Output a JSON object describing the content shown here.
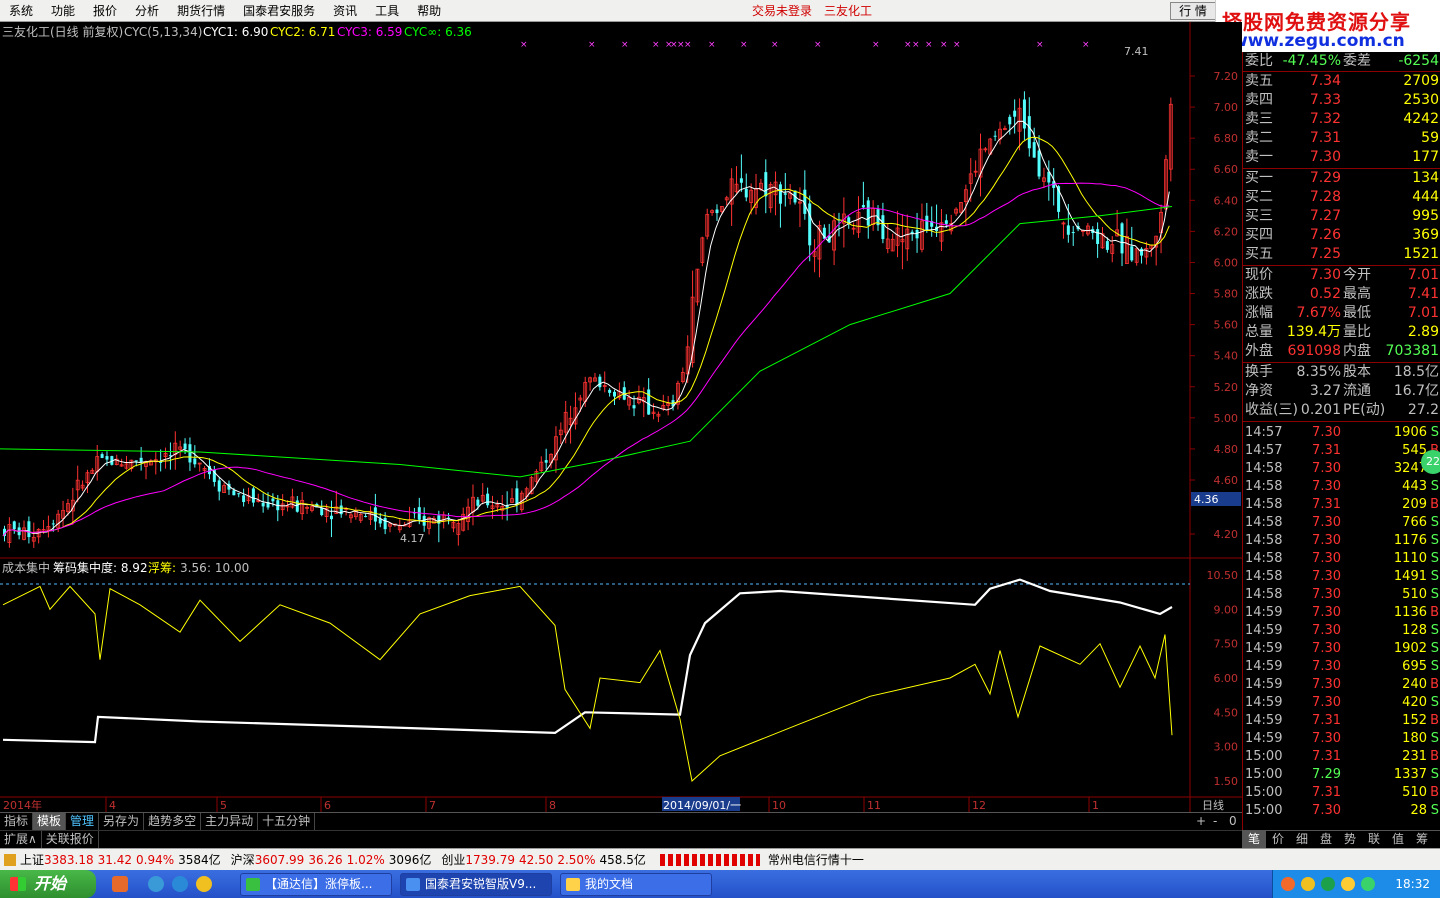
{
  "menu": {
    "items": [
      "系统",
      "功能",
      "报价",
      "分析",
      "期货行情",
      "国泰君安服务",
      "资讯",
      "工具",
      "帮助"
    ],
    "login": "交易未登录",
    "stock_name": "三友化工",
    "quote_btn": "行 情"
  },
  "watermark": {
    "line1": "择股网免费资源分享",
    "line2": "www.zegu.com.cn"
  },
  "chart_header": {
    "title": "三友化工(日线 前复权)",
    "ind": "CYC(5,13,34)",
    "c1": "CYC1: 6.90",
    "c2": "CYC2: 6.71",
    "c3": "CYC3: 6.59",
    "c4": "CYC∞: 6.36"
  },
  "sub_header": {
    "name": "成本集中",
    "a": "筹码集中度: 8.92",
    "b": "浮筹:",
    "c": "3.56",
    "d": ": 10.00"
  },
  "chart_data": {
    "type": "line",
    "price_axis": [
      "7.20",
      "7.00",
      "6.80",
      "6.60",
      "6.40",
      "6.20",
      "6.00",
      "5.80",
      "5.60",
      "5.40",
      "5.20",
      "5.00",
      "4.80",
      "4.60",
      "4.20"
    ],
    "price_marker": "4.36",
    "sub_axis": [
      "10.50",
      "9.00",
      "7.50",
      "6.00",
      "4.50",
      "3.00",
      "1.50"
    ],
    "x_labels": [
      "2014年",
      "4",
      "5",
      "6",
      "7",
      "8",
      "2014/09/01/一",
      "10",
      "11",
      "12",
      "1"
    ],
    "x_right": "日线",
    "high_label": "7.41",
    "low_label": "4.17",
    "ylim": [
      4.0,
      7.5
    ],
    "sub_ylim": [
      1.0,
      11.0
    ]
  },
  "tabs": [
    "指标",
    "模板",
    "管理",
    "另存为",
    "趋势多空",
    "主力异动",
    "十五分钟"
  ],
  "tabs2": [
    "扩展∧",
    "关联报价"
  ],
  "quote": {
    "wb": {
      "label": "委比",
      "value": "-47.45%",
      "label2": "委差",
      "value2": "-6254"
    },
    "sells": [
      {
        "label": "卖五",
        "price": "7.34",
        "vol": "2709"
      },
      {
        "label": "卖四",
        "price": "7.33",
        "vol": "2530"
      },
      {
        "label": "卖三",
        "price": "7.32",
        "vol": "4242"
      },
      {
        "label": "卖二",
        "price": "7.31",
        "vol": "59"
      },
      {
        "label": "卖一",
        "price": "7.30",
        "vol": "177"
      }
    ],
    "buys": [
      {
        "label": "买一",
        "price": "7.29",
        "vol": "134"
      },
      {
        "label": "买二",
        "price": "7.28",
        "vol": "444"
      },
      {
        "label": "买三",
        "price": "7.27",
        "vol": "995"
      },
      {
        "label": "买四",
        "price": "7.26",
        "vol": "369"
      },
      {
        "label": "买五",
        "price": "7.25",
        "vol": "1521"
      }
    ],
    "stats": [
      {
        "l1": "现价",
        "v1": "7.30",
        "l2": "今开",
        "v2": "7.01"
      },
      {
        "l1": "涨跌",
        "v1": "0.52",
        "l2": "最高",
        "v2": "7.41"
      },
      {
        "l1": "涨幅",
        "v1": "7.67%",
        "l2": "最低",
        "v2": "7.01"
      },
      {
        "l1": "总量",
        "v1": "139.4万",
        "l2": "量比",
        "v2": "2.89"
      },
      {
        "l1": "外盘",
        "v1": "691098",
        "l2": "内盘",
        "v2": "703381"
      },
      {
        "l1": "换手",
        "v1": "8.35%",
        "l2": "股本",
        "v2": "18.5亿"
      },
      {
        "l1": "净资",
        "v1": "3.27",
        "l2": "流通",
        "v2": "16.7亿"
      },
      {
        "l1": "收益(三)",
        "v1": "0.201",
        "l2": "PE(动)",
        "v2": "27.2"
      }
    ],
    "ticks": [
      [
        "14:57",
        "7.30",
        "1906",
        "S"
      ],
      [
        "14:57",
        "7.31",
        "545",
        "B"
      ],
      [
        "14:58",
        "7.30",
        "3247",
        "S"
      ],
      [
        "14:58",
        "7.30",
        "443",
        "S"
      ],
      [
        "14:58",
        "7.31",
        "209",
        "B"
      ],
      [
        "14:58",
        "7.30",
        "766",
        "S"
      ],
      [
        "14:58",
        "7.30",
        "1176",
        "S"
      ],
      [
        "14:58",
        "7.30",
        "1110",
        "S"
      ],
      [
        "14:58",
        "7.30",
        "1491",
        "S"
      ],
      [
        "14:58",
        "7.30",
        "510",
        "S"
      ],
      [
        "14:59",
        "7.30",
        "1136",
        "B"
      ],
      [
        "14:59",
        "7.30",
        "128",
        "S"
      ],
      [
        "14:59",
        "7.30",
        "1902",
        "S"
      ],
      [
        "14:59",
        "7.30",
        "695",
        "S"
      ],
      [
        "14:59",
        "7.30",
        "240",
        "B"
      ],
      [
        "14:59",
        "7.30",
        "420",
        "S"
      ],
      [
        "14:59",
        "7.31",
        "152",
        "B"
      ],
      [
        "14:59",
        "7.30",
        "180",
        "S"
      ],
      [
        "15:00",
        "7.31",
        "231",
        "B"
      ],
      [
        "15:00",
        "7.29",
        "1337",
        "S"
      ],
      [
        "15:00",
        "7.31",
        "510",
        "B"
      ],
      [
        "15:00",
        "7.30",
        "28",
        "S"
      ]
    ],
    "badge": "22"
  },
  "rtabs": [
    "笔",
    "价",
    "细",
    "盘",
    "势",
    "联",
    "值",
    "筹"
  ],
  "status": [
    {
      "name": "上证",
      "val": "3383.18",
      "chg": "31.42",
      "pct": "0.94%",
      "amt": "3584亿"
    },
    {
      "name": "沪深",
      "val": "3607.99",
      "chg": "36.26",
      "pct": "1.02%",
      "amt": "3096亿"
    },
    {
      "name": "创业",
      "val": "1739.79",
      "chg": "42.50",
      "pct": "2.50%",
      "amt": "458.5亿"
    }
  ],
  "status_news": "常州电信行情十一",
  "taskbar": {
    "start": "开始",
    "tasks": [
      "【通达信】涨停板...",
      "国泰君安锐智版V9...",
      "我的文档"
    ],
    "time": "18:32"
  },
  "colors": {
    "up": "#ff3232",
    "down": "#54ffff",
    "ma1": "#ffffff",
    "ma2": "#ffff00",
    "ma3": "#ff00ff",
    "ma4": "#00ff00"
  }
}
